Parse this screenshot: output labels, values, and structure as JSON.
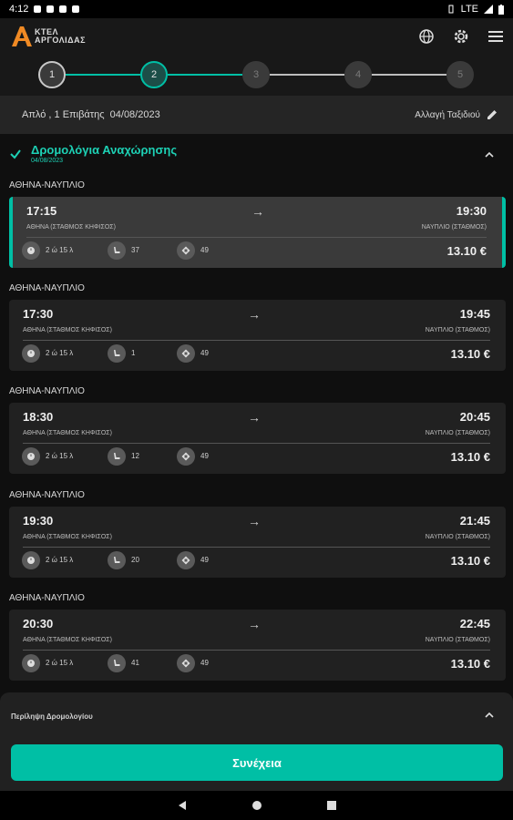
{
  "status_bar": {
    "time": "4:12",
    "network": "LTE"
  },
  "app": {
    "logo_line1": "ΚΤΕΛ",
    "logo_line2": "ΑΡΓΟΛΙΔΑΣ"
  },
  "stepper": {
    "steps": [
      "1",
      "2",
      "3",
      "4",
      "5"
    ],
    "current": 2
  },
  "summary": {
    "text": "Απλό , 1 Επιβάτης  04/08/2023",
    "change_label": "Αλλαγή Ταξιδιού"
  },
  "section": {
    "title": "Δρομολόγια Αναχώρησης",
    "date": "04/08/2023"
  },
  "trips": [
    {
      "route": "ΑΘΗΝΑ-ΝΑΥΠΛΙΟ",
      "dep_time": "17:15",
      "arr_time": "19:30",
      "from": "ΑΘΗΝΑ (ΣΤΑΘΜΟΣ ΚΗΦΙΣΟΣ)",
      "to": "ΝΑΥΠΛΙΟ (ΣΤΑΘΜΟΣ)",
      "duration": "2 ώ 15 λ",
      "seats": "37",
      "bus": "49",
      "price": "13.10 €",
      "selected": true
    },
    {
      "route": "ΑΘΗΝΑ-ΝΑΥΠΛΙΟ",
      "dep_time": "17:30",
      "arr_time": "19:45",
      "from": "ΑΘΗΝΑ (ΣΤΑΘΜΟΣ ΚΗΦΙΣΟΣ)",
      "to": "ΝΑΥΠΛΙΟ (ΣΤΑΘΜΟΣ)",
      "duration": "2 ώ 15 λ",
      "seats": "1",
      "bus": "49",
      "price": "13.10 €",
      "selected": false
    },
    {
      "route": "ΑΘΗΝΑ-ΝΑΥΠΛΙΟ",
      "dep_time": "18:30",
      "arr_time": "20:45",
      "from": "ΑΘΗΝΑ (ΣΤΑΘΜΟΣ ΚΗΦΙΣΟΣ)",
      "to": "ΝΑΥΠΛΙΟ (ΣΤΑΘΜΟΣ)",
      "duration": "2 ώ 15 λ",
      "seats": "12",
      "bus": "49",
      "price": "13.10 €",
      "selected": false
    },
    {
      "route": "ΑΘΗΝΑ-ΝΑΥΠΛΙΟ",
      "dep_time": "19:30",
      "arr_time": "21:45",
      "from": "ΑΘΗΝΑ (ΣΤΑΘΜΟΣ ΚΗΦΙΣΟΣ)",
      "to": "ΝΑΥΠΛΙΟ (ΣΤΑΘΜΟΣ)",
      "duration": "2 ώ 15 λ",
      "seats": "20",
      "bus": "49",
      "price": "13.10 €",
      "selected": false
    },
    {
      "route": "ΑΘΗΝΑ-ΝΑΥΠΛΙΟ",
      "dep_time": "20:30",
      "arr_time": "22:45",
      "from": "ΑΘΗΝΑ (ΣΤΑΘΜΟΣ ΚΗΦΙΣΟΣ)",
      "to": "ΝΑΥΠΛΙΟ (ΣΤΑΘΜΟΣ)",
      "duration": "2 ώ 15 λ",
      "seats": "41",
      "bus": "49",
      "price": "13.10 €",
      "selected": false
    }
  ],
  "bottom_sheet": {
    "summary_label": "Περίληψη Δρομολογίου",
    "continue_label": "Συνέχεια"
  },
  "colors": {
    "accent": "#00bfa5",
    "background": "#0f0f0f",
    "card": "#212121",
    "card_selected": "#3a3a3a"
  }
}
